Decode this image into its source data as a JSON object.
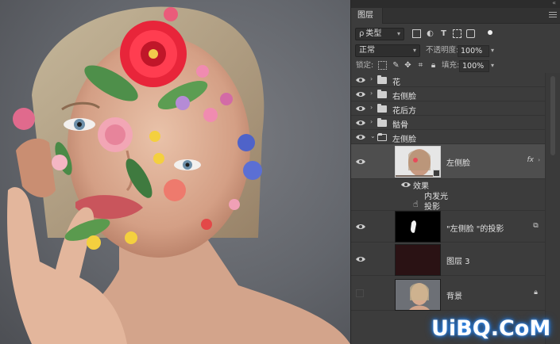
{
  "panel": {
    "collapse_glyph": "«",
    "tab_label": "图层",
    "filter": {
      "select_value": "类型",
      "search_glyph": "ρ"
    },
    "filter_icons": [
      "image-filter-icon",
      "adjustment-filter-icon",
      "type-filter-icon",
      "shape-filter-icon",
      "smart-object-filter-icon"
    ],
    "blend": {
      "mode": "正常",
      "opacity_label": "不透明度:",
      "opacity_value": "100%"
    },
    "lock": {
      "label": "锁定:",
      "fill_label": "填充:",
      "fill_value": "100%"
    },
    "layers": [
      {
        "name": "花",
        "type": "group",
        "expanded": false
      },
      {
        "name": "右侧脸",
        "type": "group",
        "expanded": false
      },
      {
        "name": "花后方",
        "type": "group",
        "expanded": false
      },
      {
        "name": "骷骨",
        "type": "group",
        "expanded": false
      },
      {
        "name": "左侧脸",
        "type": "group",
        "expanded": true
      },
      {
        "name": "左侧脸",
        "type": "smart-object",
        "fx": "fx",
        "selected": true,
        "effects_label": "效果",
        "effects": [
          "内发光",
          "投影"
        ]
      },
      {
        "name": "\"左侧脸 \"的投影",
        "type": "pixel"
      },
      {
        "name": "图层 3",
        "type": "pixel"
      },
      {
        "name": "背景",
        "type": "background",
        "locked": true
      }
    ]
  },
  "watermark": "UiBQ.CoM",
  "colors": {
    "panel_bg": "#3c3c3c",
    "selected_row": "#4e4e4e",
    "canvas_bg": "#6b6d72",
    "flower_red": "#e8253a"
  }
}
